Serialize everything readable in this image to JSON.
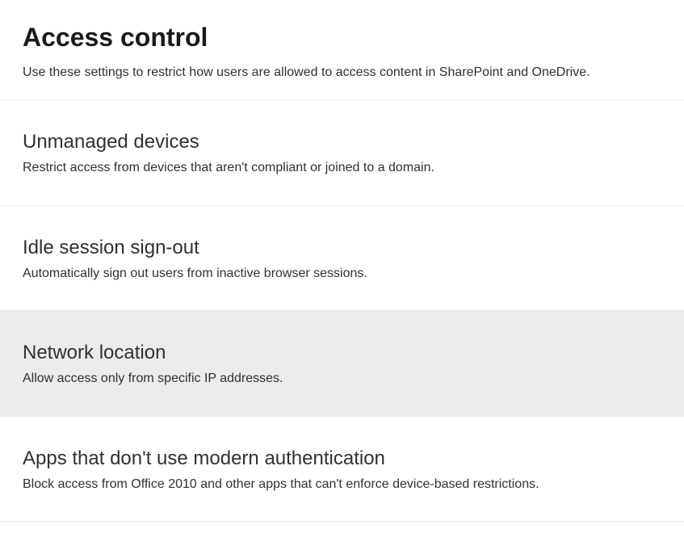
{
  "header": {
    "title": "Access control",
    "description": "Use these settings to restrict how users are allowed to access content in SharePoint and OneDrive."
  },
  "settings": [
    {
      "title": "Unmanaged devices",
      "description": "Restrict access from devices that aren't compliant or joined to a domain.",
      "hovered": false
    },
    {
      "title": "Idle session sign-out",
      "description": "Automatically sign out users from inactive browser sessions.",
      "hovered": false
    },
    {
      "title": "Network location",
      "description": "Allow access only from specific IP addresses.",
      "hovered": true
    },
    {
      "title": "Apps that don't use modern authentication",
      "description": "Block access from Office 2010 and other apps that can't enforce device-based restrictions.",
      "hovered": false
    }
  ]
}
